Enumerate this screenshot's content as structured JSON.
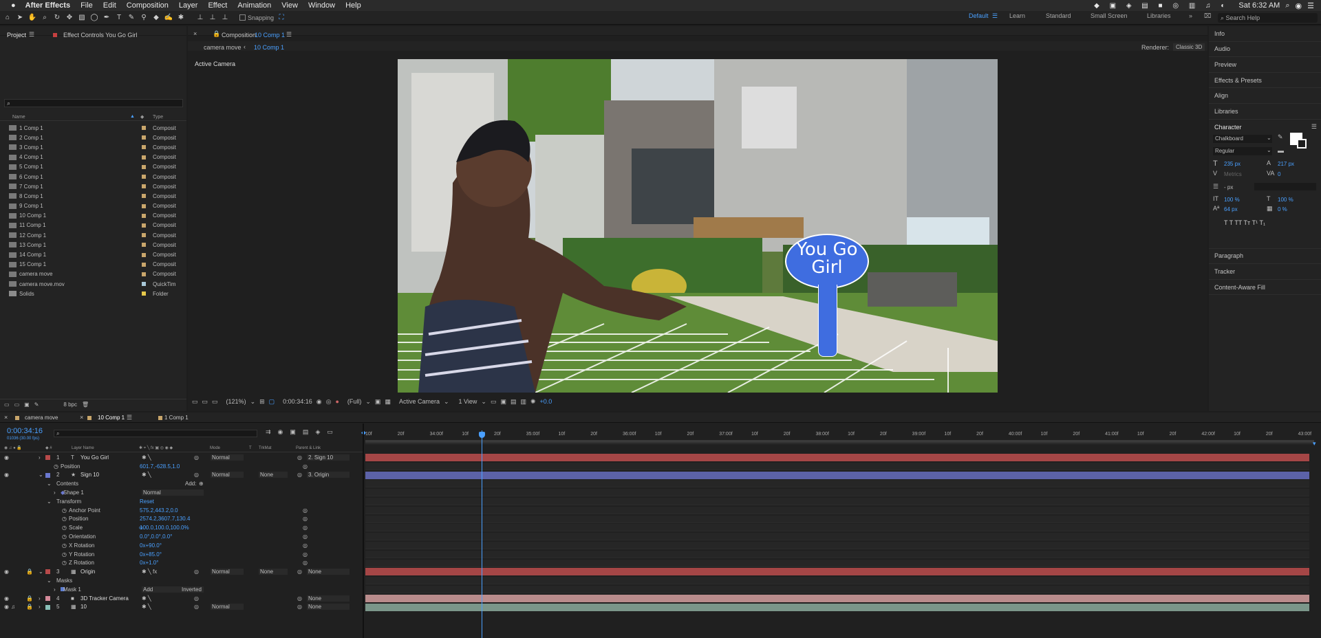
{
  "menubar": {
    "app": "After Effects",
    "items": [
      "File",
      "Edit",
      "Composition",
      "Layer",
      "Effect",
      "Animation",
      "View",
      "Window",
      "Help"
    ],
    "clock": "Sat 6:32 AM"
  },
  "toolbar": {
    "snapping": "Snapping"
  },
  "workspaces": [
    "Default",
    "Learn",
    "Standard",
    "Small Screen",
    "Libraries"
  ],
  "search_help": "Search Help",
  "project": {
    "tab": "Project",
    "effect_tab": "Effect Controls You Go Girl",
    "col_name": "Name",
    "col_type": "Type",
    "items": [
      {
        "name": "1 Comp 1",
        "type": "Composit",
        "color": "#c9a66b"
      },
      {
        "name": "2 Comp 1",
        "type": "Composit",
        "color": "#c9a66b"
      },
      {
        "name": "3 Comp 1",
        "type": "Composit",
        "color": "#c9a66b"
      },
      {
        "name": "4 Comp 1",
        "type": "Composit",
        "color": "#c9a66b"
      },
      {
        "name": "5 Comp 1",
        "type": "Composit",
        "color": "#c9a66b"
      },
      {
        "name": "6 Comp 1",
        "type": "Composit",
        "color": "#c9a66b"
      },
      {
        "name": "7 Comp 1",
        "type": "Composit",
        "color": "#c9a66b"
      },
      {
        "name": "8 Comp 1",
        "type": "Composit",
        "color": "#c9a66b"
      },
      {
        "name": "9 Comp 1",
        "type": "Composit",
        "color": "#c9a66b"
      },
      {
        "name": "10 Comp 1",
        "type": "Composit",
        "color": "#c9a66b"
      },
      {
        "name": "11 Comp 1",
        "type": "Composit",
        "color": "#c9a66b"
      },
      {
        "name": "12 Comp 1",
        "type": "Composit",
        "color": "#c9a66b"
      },
      {
        "name": "13 Comp 1",
        "type": "Composit",
        "color": "#c9a66b"
      },
      {
        "name": "14 Comp 1",
        "type": "Composit",
        "color": "#c9a66b"
      },
      {
        "name": "15 Comp 1",
        "type": "Composit",
        "color": "#c9a66b"
      },
      {
        "name": "camera move",
        "type": "Composit",
        "color": "#c9a66b"
      },
      {
        "name": "camera move.mov",
        "type": "QuickTim",
        "color": "#a8c8d8"
      },
      {
        "name": "Solids",
        "type": "Folder",
        "color": "#e6c84a"
      }
    ],
    "bpc": "8 bpc"
  },
  "composition": {
    "tab_prefix": "Composition",
    "tab_name": "10 Comp 1",
    "crumb1": "camera move",
    "crumb2": "10 Comp 1",
    "renderer_label": "Renderer:",
    "renderer": "Classic 3D",
    "active_camera": "Active Camera",
    "sign_text": "You Go Girl",
    "footer": {
      "zoom": "(121%)",
      "time": "0:00:34:16",
      "quality": "(Full)",
      "camera": "Active Camera",
      "views": "1 View",
      "exposure": "+0.0"
    }
  },
  "right_panel": {
    "items": [
      "Info",
      "Audio",
      "Preview",
      "Effects & Presets",
      "Align",
      "Libraries"
    ],
    "character": {
      "title": "Character",
      "font": "Chalkboard",
      "style": "Regular",
      "size": "235 px",
      "leading": "217 px",
      "kerning": "Metrics",
      "tracking": "0",
      "stroke": "- px",
      "vscale": "100 %",
      "hscale": "100 %",
      "baseline": "64 px",
      "tsume": "0 %",
      "styles": "T  T  TT  Tт  T¹  T₁"
    },
    "lower": [
      "Paragraph",
      "Tracker",
      "Content-Aware Fill"
    ]
  },
  "timeline": {
    "tabs": [
      "camera move",
      "10 Comp 1",
      "1 Comp 1"
    ],
    "timecode": "0:00:34:16",
    "fps": "01036 (30.00 fps)",
    "headers": {
      "layer_name": "Layer Name",
      "mode": "Mode",
      "t": "T",
      "trkmat": "TrkMat",
      "parent": "Parent & Link"
    },
    "ruler": [
      "10f",
      "20f",
      "34:00f",
      "10f",
      "20f",
      "35:00f",
      "10f",
      "20f",
      "36:00f",
      "10f",
      "20f",
      "37:00f",
      "10f",
      "20f",
      "38:00f",
      "10f",
      "20f",
      "39:00f",
      "10f",
      "20f",
      "40:00f",
      "10f",
      "20f",
      "41:00f",
      "10f",
      "20f",
      "42:00f",
      "10f",
      "20f",
      "43:00f"
    ],
    "rows": [
      {
        "num": "1",
        "name": "You Go Girl",
        "icon": "T",
        "mode": "Normal",
        "trk": "",
        "parent": "2. Sign 10",
        "label": "#b84a4a",
        "indent": 0,
        "bar": "#a54646"
      },
      {
        "name": "Position",
        "value": "601.7,-628.5,1.0",
        "indent": 2,
        "prop": true
      },
      {
        "num": "2",
        "name": "Sign 10",
        "icon": "★",
        "mode": "Normal",
        "trk": "None",
        "parent": "3. Origin",
        "label": "#6a78d0",
        "indent": 0,
        "bar": "#5c62a8"
      },
      {
        "name": "Contents",
        "value": "",
        "indent": 1,
        "prop": true,
        "add": "Add:"
      },
      {
        "name": "Shape 1",
        "value": "",
        "mode": "Normal",
        "indent": 2,
        "prop": true
      },
      {
        "name": "Transform",
        "value": "Reset",
        "indent": 1,
        "prop": true
      },
      {
        "name": "Anchor Point",
        "value": "575.2,443.2,0.0",
        "indent": 3,
        "prop": true
      },
      {
        "name": "Position",
        "value": "2574.2,3607.7,130.4",
        "indent": 3,
        "prop": true
      },
      {
        "name": "Scale",
        "value": "100.0,100.0,100.0%",
        "indent": 3,
        "prop": true
      },
      {
        "name": "Orientation",
        "value": "0.0°,0.0°,0.0°",
        "indent": 3,
        "prop": true
      },
      {
        "name": "X Rotation",
        "value": "0x+90.0°",
        "indent": 3,
        "prop": true
      },
      {
        "name": "Y Rotation",
        "value": "0x+85.0°",
        "indent": 3,
        "prop": true
      },
      {
        "name": "Z Rotation",
        "value": "0x+1.0°",
        "indent": 3,
        "prop": true
      },
      {
        "num": "3",
        "name": "Origin",
        "icon": "▦",
        "mode": "Normal",
        "trk": "None",
        "parent": "None",
        "label": "#b84a4a",
        "indent": 0,
        "bar": "#a54646"
      },
      {
        "name": "Masks",
        "value": "",
        "indent": 1,
        "prop": true
      },
      {
        "name": "Mask 1",
        "value": "",
        "mode": "Add",
        "extra": "Inverted",
        "indent": 2,
        "prop": true
      },
      {
        "num": "4",
        "name": "3D Tracker Camera",
        "icon": "■",
        "mode": "",
        "trk": "",
        "parent": "None",
        "label": "#d48a9a",
        "indent": 0,
        "bar": "#b98c8c"
      },
      {
        "num": "5",
        "name": "10",
        "icon": "▦",
        "mode": "Normal",
        "trk": "",
        "parent": "None",
        "label": "#8ac0b8",
        "indent": 0,
        "bar": "#7b968a"
      }
    ]
  }
}
